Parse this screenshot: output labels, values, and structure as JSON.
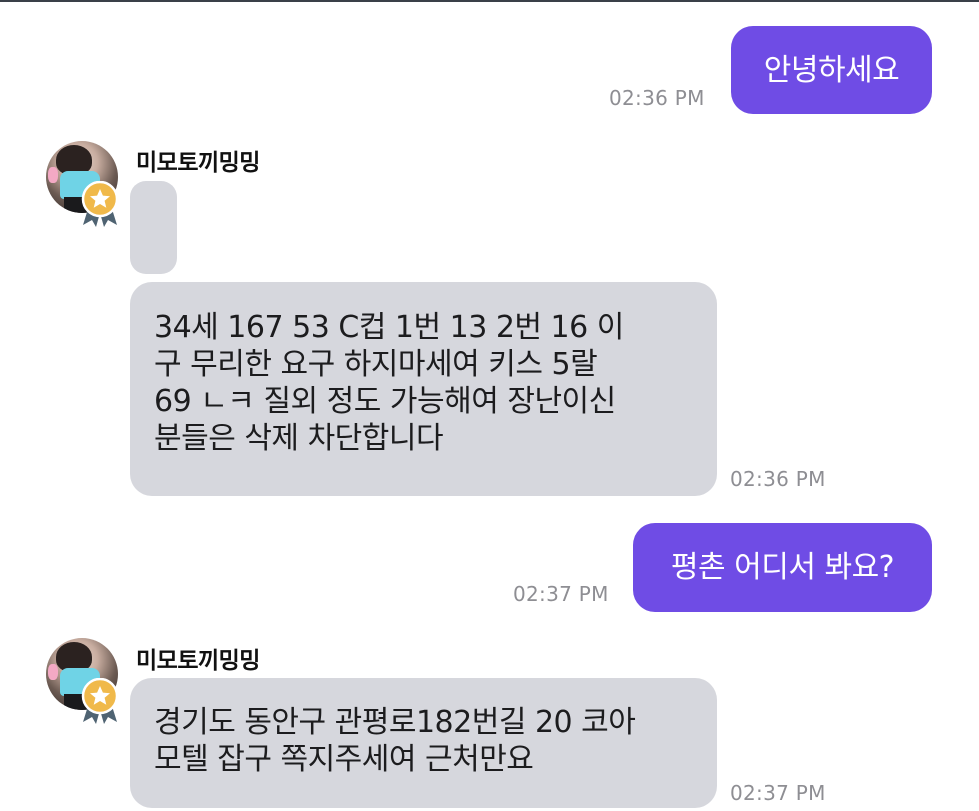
{
  "messages": {
    "m1": {
      "text": "안녕하세요",
      "time": "02:36 PM"
    },
    "m2": {
      "sender": "미모토끼밍밍",
      "text": "",
      "time": ""
    },
    "m3": {
      "text": "34세 167  53  C컵 1번 13 2번 16  이\n구 무리한 요구 하지마세여 키스 5랄\n69 ㄴㅋ 질외 정도 가능해여 장난이신\n분들은 삭제 차단합니다",
      "time": "02:36 PM"
    },
    "m4": {
      "text": "평촌 어디서 봐요?",
      "time": "02:37 PM"
    },
    "m5": {
      "sender": "미모토끼밍밍",
      "text": "경기도 동안구 관평로182번길 20 코아\n모텔 잡구 쪽지주세여 근처만요",
      "time": "02:37 PM"
    }
  },
  "colors": {
    "outgoing_bubble": "#6f4ce5",
    "incoming_bubble": "#d6d7dd",
    "timestamp": "#8e8e93"
  },
  "icons": {
    "avatar": "profile-photo",
    "badge": "star-medal-icon"
  }
}
